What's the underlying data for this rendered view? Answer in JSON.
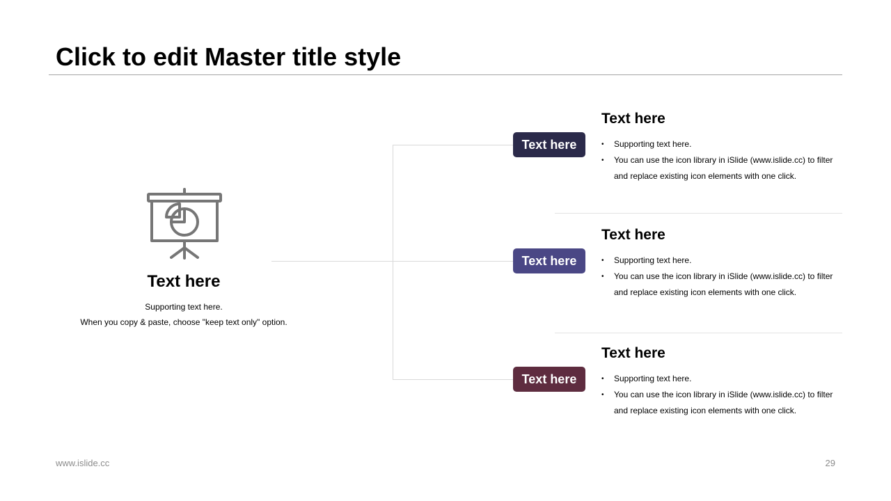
{
  "slide": {
    "title": "Click to edit Master title style",
    "footer_left": "www.islide.cc",
    "page_number": "29"
  },
  "left_panel": {
    "icon": "presentation-pie-chart-icon",
    "heading": "Text here",
    "support_lines": [
      "Supporting text here.",
      "When you copy & paste, choose \"keep text only\" option."
    ]
  },
  "items": [
    {
      "pill_label": "Text here",
      "pill_color": "#2b2a4a",
      "heading": "Text here",
      "bullets": [
        "Supporting text here.",
        "You can use the icon library in iSlide  (www.islide.cc) to filter and replace existing icon elements with one click."
      ]
    },
    {
      "pill_label": "Text here",
      "pill_color": "#4a4785",
      "heading": "Text here",
      "bullets": [
        "Supporting text here.",
        "You can use the icon library in iSlide  (www.islide.cc) to filter and replace existing icon elements with one click."
      ]
    },
    {
      "pill_label": "Text here",
      "pill_color": "#5e2c3f",
      "heading": "Text here",
      "bullets": [
        "Supporting text here.",
        "You can use the icon library in iSlide  (www.islide.cc) to filter and replace existing icon elements with one click."
      ]
    }
  ],
  "colors": {
    "icon_stroke": "#767676",
    "connector": "#d9d9d9"
  }
}
